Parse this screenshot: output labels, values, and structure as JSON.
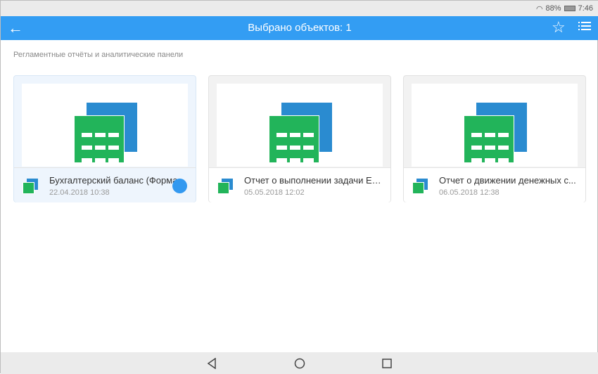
{
  "status_bar": {
    "battery": "88%",
    "time": "7:46"
  },
  "app_bar": {
    "title": "Выбрано объектов: 1"
  },
  "section_title": "Регламентные отчёты и аналитические панели",
  "cards": [
    {
      "name": "Бухгалтерский баланс (Форма",
      "date": "22.04.2018 10:38",
      "selected": true
    },
    {
      "name": "Отчет о выполнении задачи ETL",
      "date": "05.05.2018 12:02",
      "selected": false
    },
    {
      "name": "Отчет о движении денежных с...",
      "date": "06.05.2018 12:38",
      "selected": false
    }
  ],
  "colors": {
    "accent": "#339df3",
    "green": "#22b45a",
    "blue": "#2a8bd0"
  }
}
